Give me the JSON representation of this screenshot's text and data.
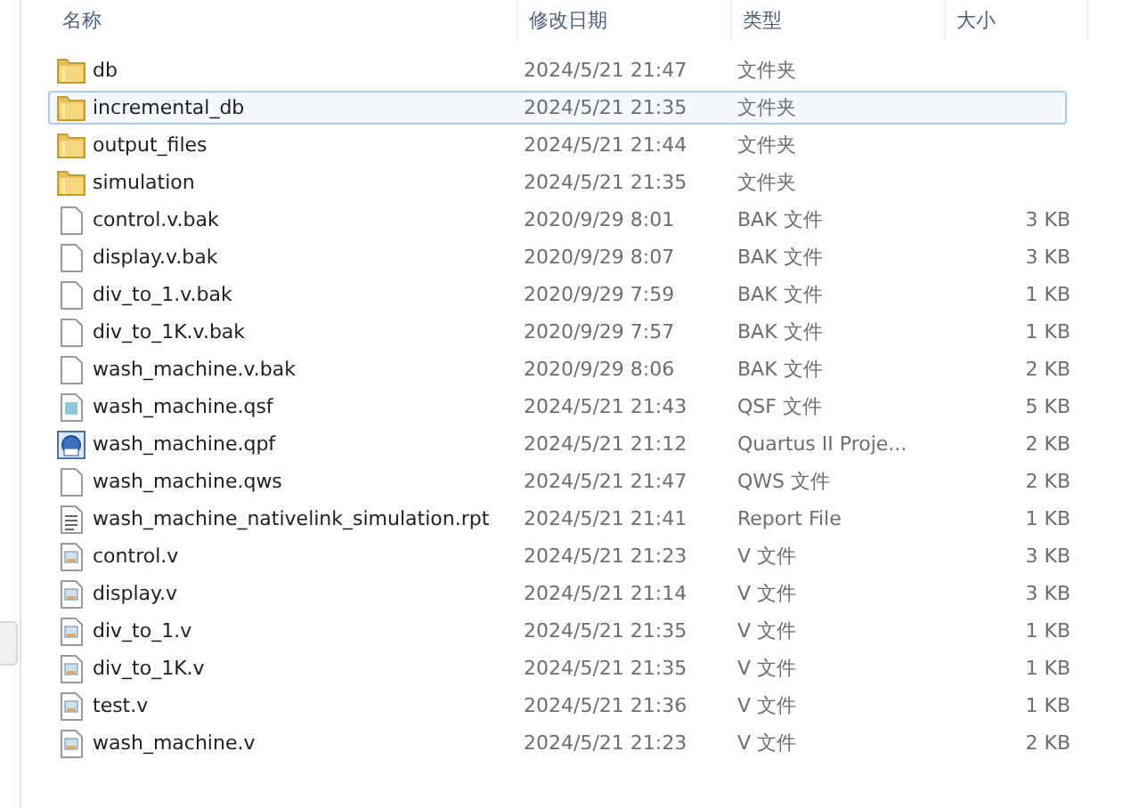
{
  "columns": [
    {
      "label": "名称"
    },
    {
      "label": "修改日期"
    },
    {
      "label": "类型"
    },
    {
      "label": "大小"
    }
  ],
  "files": [
    {
      "name": "db",
      "modified": "2024/5/21 21:47",
      "type": "文件夹",
      "kind": "folder",
      "selected": false
    },
    {
      "name": "incremental_db",
      "modified": "2024/5/21 21:35",
      "type": "文件夹",
      "kind": "folder",
      "selected": true
    },
    {
      "name": "output_files",
      "modified": "2024/5/21 21:44",
      "type": "文件夹",
      "kind": "folder",
      "selected": false
    },
    {
      "name": "simulation",
      "modified": "2024/5/21 21:35",
      "type": "文件夹",
      "kind": "folder",
      "selected": false
    },
    {
      "name": "control.v.bak",
      "modified": "2020/9/29 8:01",
      "type": "BAK 文件",
      "size": "3 KB",
      "kind": "blank",
      "selected": false
    },
    {
      "name": "display.v.bak",
      "modified": "2020/9/29 8:07",
      "type": "BAK 文件",
      "size": "3 KB",
      "kind": "blank",
      "selected": false
    },
    {
      "name": "div_to_1.v.bak",
      "modified": "2020/9/29 7:59",
      "type": "BAK 文件",
      "size": "1 KB",
      "kind": "blank",
      "selected": false
    },
    {
      "name": "div_to_1K.v.bak",
      "modified": "2020/9/29 7:57",
      "type": "BAK 文件",
      "size": "1 KB",
      "kind": "blank",
      "selected": false
    },
    {
      "name": "wash_machine.v.bak",
      "modified": "2020/9/29 8:06",
      "type": "BAK 文件",
      "size": "2 KB",
      "kind": "blank",
      "selected": false
    },
    {
      "name": "wash_machine.qsf",
      "modified": "2024/5/21 21:43",
      "type": "QSF 文件",
      "size": "5 KB",
      "kind": "settings",
      "selected": false
    },
    {
      "name": "wash_machine.qpf",
      "modified": "2024/5/21 21:12",
      "type": "Quartus II Proje...",
      "size": "2 KB",
      "kind": "project",
      "selected": false
    },
    {
      "name": "wash_machine.qws",
      "modified": "2024/5/21 21:47",
      "type": "QWS 文件",
      "size": "2 KB",
      "kind": "blank",
      "selected": false
    },
    {
      "name": "wash_machine_nativelink_simulation.rpt",
      "modified": "2024/5/21 21:41",
      "type": "Report File",
      "size": "1 KB",
      "kind": "text",
      "selected": false
    },
    {
      "name": "control.v",
      "modified": "2024/5/21 21:23",
      "type": "V 文件",
      "size": "3 KB",
      "kind": "source",
      "selected": false
    },
    {
      "name": "display.v",
      "modified": "2024/5/21 21:14",
      "type": "V 文件",
      "size": "3 KB",
      "kind": "source",
      "selected": false
    },
    {
      "name": "div_to_1.v",
      "modified": "2024/5/21 21:35",
      "type": "V 文件",
      "size": "1 KB",
      "kind": "source",
      "selected": false
    },
    {
      "name": "div_to_1K.v",
      "modified": "2024/5/21 21:35",
      "type": "V 文件",
      "size": "1 KB",
      "kind": "source",
      "selected": false
    },
    {
      "name": "test.v",
      "modified": "2024/5/21 21:36",
      "type": "V 文件",
      "size": "1 KB",
      "kind": "source",
      "selected": false
    },
    {
      "name": "wash_machine.v",
      "modified": "2024/5/21 21:23",
      "type": "V 文件",
      "size": "2 KB",
      "kind": "source",
      "selected": false
    }
  ]
}
